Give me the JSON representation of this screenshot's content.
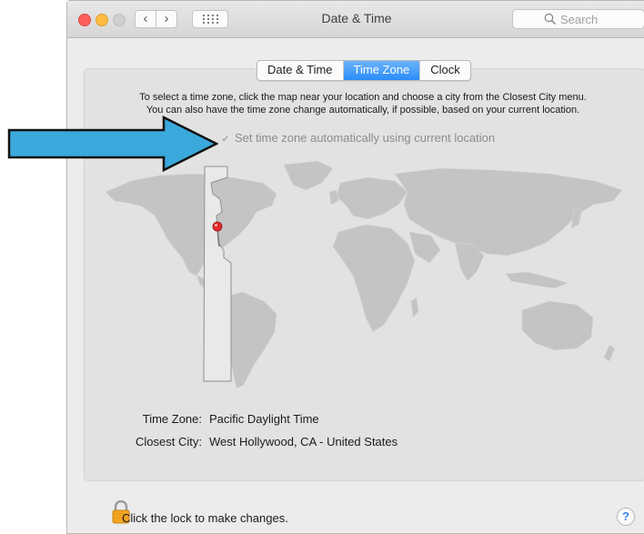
{
  "window": {
    "title": "Date & Time",
    "search_placeholder": "Search"
  },
  "tabs": [
    {
      "label": "Date & Time",
      "active": false
    },
    {
      "label": "Time Zone",
      "active": true
    },
    {
      "label": "Clock",
      "active": false
    }
  ],
  "description": {
    "line1": "To select a time zone, click the map near your location and choose a city from the Closest City menu.",
    "line2": "You can also have the time zone change automatically, if possible, based on your current location."
  },
  "auto_checkbox": {
    "label": "Set time zone automatically using current location",
    "checked": true
  },
  "timezone": {
    "tz_label": "Time Zone:",
    "tz_value": "Pacific Daylight Time",
    "city_label": "Closest City:",
    "city_value": "West Hollywood, CA - United States"
  },
  "footer": {
    "lock_text": "Click the lock to make changes.",
    "help": "?"
  },
  "colors": {
    "accent": "#2a8cf7",
    "arrow": "#3aa9db",
    "pin": "#e22b2b"
  }
}
